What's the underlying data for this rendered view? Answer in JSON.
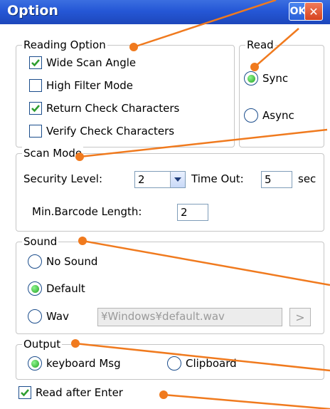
{
  "window": {
    "title": "Option",
    "ok_label": "OK",
    "close_label": "✕"
  },
  "reading_option": {
    "legend": "Reading Option",
    "items": [
      {
        "label": "Wide Scan Angle",
        "checked": true
      },
      {
        "label": "High Filter Mode",
        "checked": false
      },
      {
        "label": "Return Check Characters",
        "checked": true
      },
      {
        "label": "Verify Check Characters",
        "checked": false
      }
    ]
  },
  "read": {
    "legend": "Read",
    "options": [
      {
        "label": "Sync",
        "selected": true
      },
      {
        "label": "Async",
        "selected": false
      }
    ]
  },
  "scan_mode": {
    "legend": "Scan Mode",
    "security_label": "Security Level:",
    "security_value": "2",
    "timeout_label": "Time Out:",
    "timeout_value": "5",
    "timeout_unit": "sec",
    "min_length_label": "Min.Barcode Length:",
    "min_length_value": "2"
  },
  "sound": {
    "legend": "Sound",
    "options": [
      {
        "label": "No Sound",
        "selected": false
      },
      {
        "label": "Default",
        "selected": true
      },
      {
        "label": "Wav",
        "selected": false
      }
    ],
    "wav_path": "¥Windows¥default.wav",
    "browse_label": ">"
  },
  "output": {
    "legend": "Output",
    "options": [
      {
        "label": "keyboard Msg",
        "selected": true
      },
      {
        "label": "Clipboard",
        "selected": false
      }
    ]
  },
  "read_after_enter": {
    "label": "Read after Enter",
    "checked": true
  },
  "colors": {
    "title_bar": "#2557d6",
    "annotation": "#f07a1e",
    "check": "#2f9e2f",
    "radio_fill": "#22a322"
  }
}
